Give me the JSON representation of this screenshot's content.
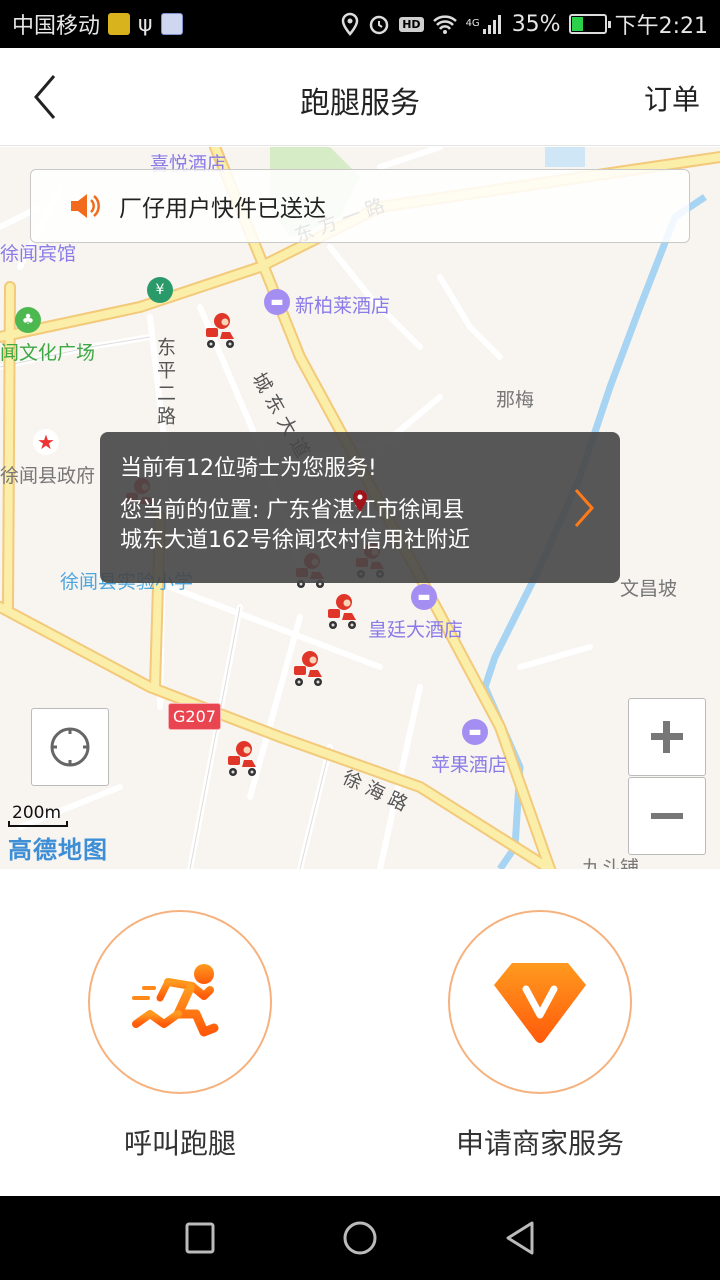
{
  "status_bar": {
    "carrier": "中国移动",
    "network": "4G",
    "battery_percent": "35%",
    "battery_level": 0.35,
    "time": "下午2:21"
  },
  "header": {
    "title": "跑腿服务",
    "orders_label": "订单"
  },
  "map": {
    "notice_text": "厂仔用户快件已送达",
    "info": {
      "riders_line": "当前有12位骑士为您服务!",
      "location_line1": "您当前的位置: 广东省湛江市徐闻县",
      "location_line2": "城东大道162号徐闻农村信用社附近"
    },
    "labels": {
      "xiyue_hotel": "喜悦酒店",
      "xuwen_guesthouse": "徐闻宾馆",
      "dongfang_road": "东方一路",
      "xinbolai_hotel": "新柏莱酒店",
      "culture_square": "闻文化广场",
      "dongping_road": "东平二路",
      "chengdong_avenue": "城东大道",
      "namei": "那梅",
      "county_gov": "徐闻县政府",
      "experimental_school": "徐闻县实验小学",
      "wenchangpo": "文昌坡",
      "huangting_hotel": "皇廷大酒店",
      "apple_hotel": "苹果酒店",
      "xuhai_road": "徐海路",
      "jiudoupu": "九斗铺",
      "g207": "G207",
      "scale": "200m",
      "map_provider": "高德地图"
    },
    "zoom_in_label": "+",
    "zoom_out_label": "−"
  },
  "actions": [
    {
      "label": "呼叫跑腿",
      "icon": "runner-icon"
    },
    {
      "label": "申请商家服务",
      "icon": "diamond-v-icon"
    }
  ],
  "colors": {
    "accent": "#ff7a1a",
    "rider": "#e0362a"
  }
}
